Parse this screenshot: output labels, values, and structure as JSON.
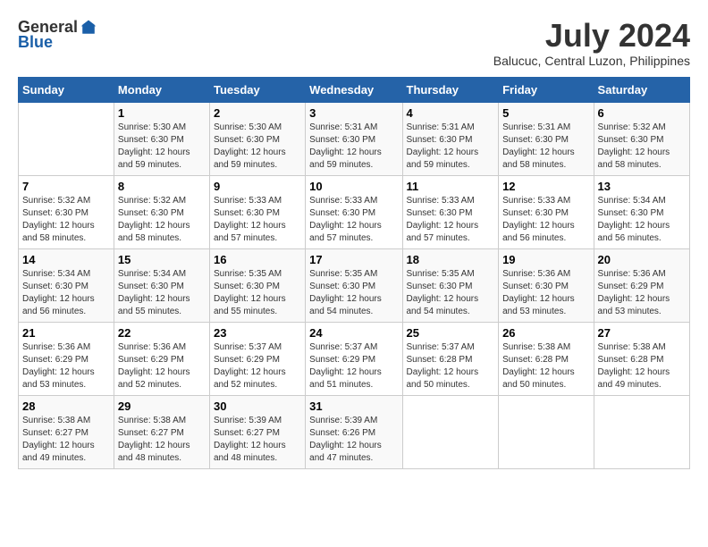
{
  "logo": {
    "text_general": "General",
    "text_blue": "Blue"
  },
  "title": "July 2024",
  "subtitle": "Balucuc, Central Luzon, Philippines",
  "days_of_week": [
    "Sunday",
    "Monday",
    "Tuesday",
    "Wednesday",
    "Thursday",
    "Friday",
    "Saturday"
  ],
  "weeks": [
    [
      {
        "day": "",
        "info": ""
      },
      {
        "day": "1",
        "info": "Sunrise: 5:30 AM\nSunset: 6:30 PM\nDaylight: 12 hours\nand 59 minutes."
      },
      {
        "day": "2",
        "info": "Sunrise: 5:30 AM\nSunset: 6:30 PM\nDaylight: 12 hours\nand 59 minutes."
      },
      {
        "day": "3",
        "info": "Sunrise: 5:31 AM\nSunset: 6:30 PM\nDaylight: 12 hours\nand 59 minutes."
      },
      {
        "day": "4",
        "info": "Sunrise: 5:31 AM\nSunset: 6:30 PM\nDaylight: 12 hours\nand 59 minutes."
      },
      {
        "day": "5",
        "info": "Sunrise: 5:31 AM\nSunset: 6:30 PM\nDaylight: 12 hours\nand 58 minutes."
      },
      {
        "day": "6",
        "info": "Sunrise: 5:32 AM\nSunset: 6:30 PM\nDaylight: 12 hours\nand 58 minutes."
      }
    ],
    [
      {
        "day": "7",
        "info": "Sunrise: 5:32 AM\nSunset: 6:30 PM\nDaylight: 12 hours\nand 58 minutes."
      },
      {
        "day": "8",
        "info": "Sunrise: 5:32 AM\nSunset: 6:30 PM\nDaylight: 12 hours\nand 58 minutes."
      },
      {
        "day": "9",
        "info": "Sunrise: 5:33 AM\nSunset: 6:30 PM\nDaylight: 12 hours\nand 57 minutes."
      },
      {
        "day": "10",
        "info": "Sunrise: 5:33 AM\nSunset: 6:30 PM\nDaylight: 12 hours\nand 57 minutes."
      },
      {
        "day": "11",
        "info": "Sunrise: 5:33 AM\nSunset: 6:30 PM\nDaylight: 12 hours\nand 57 minutes."
      },
      {
        "day": "12",
        "info": "Sunrise: 5:33 AM\nSunset: 6:30 PM\nDaylight: 12 hours\nand 56 minutes."
      },
      {
        "day": "13",
        "info": "Sunrise: 5:34 AM\nSunset: 6:30 PM\nDaylight: 12 hours\nand 56 minutes."
      }
    ],
    [
      {
        "day": "14",
        "info": "Sunrise: 5:34 AM\nSunset: 6:30 PM\nDaylight: 12 hours\nand 56 minutes."
      },
      {
        "day": "15",
        "info": "Sunrise: 5:34 AM\nSunset: 6:30 PM\nDaylight: 12 hours\nand 55 minutes."
      },
      {
        "day": "16",
        "info": "Sunrise: 5:35 AM\nSunset: 6:30 PM\nDaylight: 12 hours\nand 55 minutes."
      },
      {
        "day": "17",
        "info": "Sunrise: 5:35 AM\nSunset: 6:30 PM\nDaylight: 12 hours\nand 54 minutes."
      },
      {
        "day": "18",
        "info": "Sunrise: 5:35 AM\nSunset: 6:30 PM\nDaylight: 12 hours\nand 54 minutes."
      },
      {
        "day": "19",
        "info": "Sunrise: 5:36 AM\nSunset: 6:30 PM\nDaylight: 12 hours\nand 53 minutes."
      },
      {
        "day": "20",
        "info": "Sunrise: 5:36 AM\nSunset: 6:29 PM\nDaylight: 12 hours\nand 53 minutes."
      }
    ],
    [
      {
        "day": "21",
        "info": "Sunrise: 5:36 AM\nSunset: 6:29 PM\nDaylight: 12 hours\nand 53 minutes."
      },
      {
        "day": "22",
        "info": "Sunrise: 5:36 AM\nSunset: 6:29 PM\nDaylight: 12 hours\nand 52 minutes."
      },
      {
        "day": "23",
        "info": "Sunrise: 5:37 AM\nSunset: 6:29 PM\nDaylight: 12 hours\nand 52 minutes."
      },
      {
        "day": "24",
        "info": "Sunrise: 5:37 AM\nSunset: 6:29 PM\nDaylight: 12 hours\nand 51 minutes."
      },
      {
        "day": "25",
        "info": "Sunrise: 5:37 AM\nSunset: 6:28 PM\nDaylight: 12 hours\nand 50 minutes."
      },
      {
        "day": "26",
        "info": "Sunrise: 5:38 AM\nSunset: 6:28 PM\nDaylight: 12 hours\nand 50 minutes."
      },
      {
        "day": "27",
        "info": "Sunrise: 5:38 AM\nSunset: 6:28 PM\nDaylight: 12 hours\nand 49 minutes."
      }
    ],
    [
      {
        "day": "28",
        "info": "Sunrise: 5:38 AM\nSunset: 6:27 PM\nDaylight: 12 hours\nand 49 minutes."
      },
      {
        "day": "29",
        "info": "Sunrise: 5:38 AM\nSunset: 6:27 PM\nDaylight: 12 hours\nand 48 minutes."
      },
      {
        "day": "30",
        "info": "Sunrise: 5:39 AM\nSunset: 6:27 PM\nDaylight: 12 hours\nand 48 minutes."
      },
      {
        "day": "31",
        "info": "Sunrise: 5:39 AM\nSunset: 6:26 PM\nDaylight: 12 hours\nand 47 minutes."
      },
      {
        "day": "",
        "info": ""
      },
      {
        "day": "",
        "info": ""
      },
      {
        "day": "",
        "info": ""
      }
    ]
  ]
}
